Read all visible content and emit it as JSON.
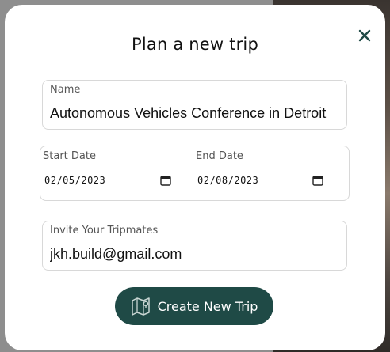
{
  "modal": {
    "title": "Plan a new trip",
    "close_icon": "close-icon"
  },
  "name_field": {
    "label": "Name",
    "value": "Autonomous Vehicles Conference in Detroit"
  },
  "dates": {
    "start_label": "Start Date",
    "start_value": "02/05/2023",
    "end_label": "End Date",
    "end_value": "02/08/2023",
    "calendar_icon": "calendar-icon"
  },
  "tripmates_field": {
    "label": "Invite Your Tripmates",
    "value": "jkh.build@gmail.com"
  },
  "create_button": {
    "label": "Create New Trip",
    "icon": "map-icon",
    "color": "#1f4a46"
  }
}
